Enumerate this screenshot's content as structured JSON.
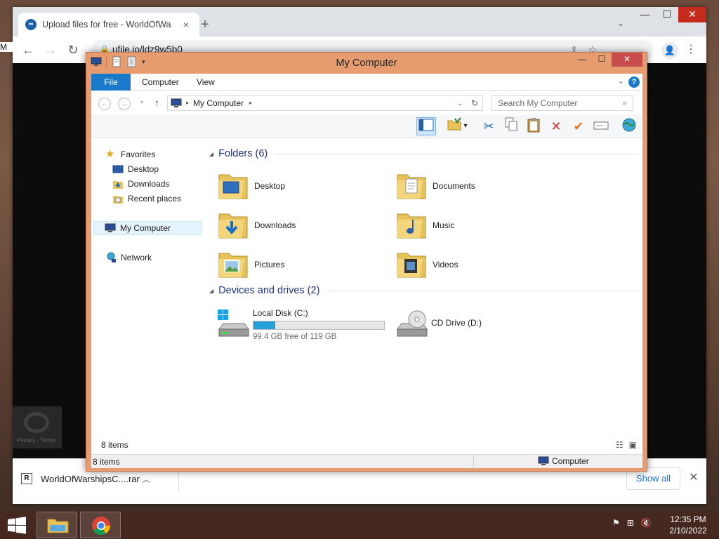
{
  "browser": {
    "tab_title": "Upload files for free - WorldOfWa",
    "tab_close": "×",
    "new_tab": "+",
    "url": "ufile.io/ldz9w5b0",
    "show_all": "Show all",
    "left_edge_letter": "M",
    "recaptcha_text": "Privacy - Terms"
  },
  "download": {
    "filename": "WorldOfWarshipsC....rar"
  },
  "explorer": {
    "title": "My Computer",
    "ribbon_tabs": [
      "File",
      "Computer",
      "View"
    ],
    "address_path": "My Computer",
    "search_placeholder": "Search My Computer",
    "nav": {
      "favorites": "Favorites",
      "desktop": "Desktop",
      "downloads": "Downloads",
      "recent": "Recent places",
      "my_computer": "My Computer",
      "network": "Network"
    },
    "folders_header": "Folders (6)",
    "folders": [
      {
        "name": "Desktop",
        "icon": "desktop-folder"
      },
      {
        "name": "Documents",
        "icon": "documents-folder"
      },
      {
        "name": "Downloads",
        "icon": "downloads-folder"
      },
      {
        "name": "Music",
        "icon": "music-folder"
      },
      {
        "name": "Pictures",
        "icon": "pictures-folder"
      },
      {
        "name": "Videos",
        "icon": "videos-folder"
      }
    ],
    "devices_header": "Devices and drives (2)",
    "drives": [
      {
        "name": "Local Disk (C:)",
        "free_text": "99.4 GB free of 119 GB",
        "used_fraction": 0.165
      },
      {
        "name": "CD Drive (D:)"
      }
    ],
    "item_count": "8 items",
    "status_count": "8 items",
    "status_zone": "Computer"
  },
  "taskbar": {
    "time": "12:35 PM",
    "date": "2/10/2022"
  },
  "colors": {
    "accent": "#1979ca",
    "window_frame": "#e69c6e",
    "group_header": "#1e3287",
    "drive_fill": "#26a0da"
  }
}
